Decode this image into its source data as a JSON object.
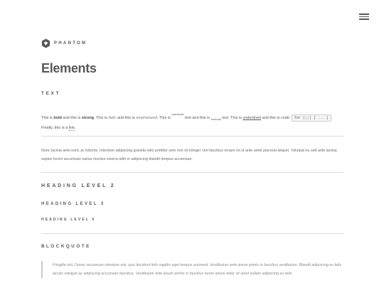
{
  "header": {
    "brand": "PHANTOM"
  },
  "page": {
    "title": "Elements"
  },
  "text_section": {
    "heading": "TEXT",
    "p1": [
      "This is ",
      "bold",
      " and this is ",
      "strong",
      ". This is ",
      "italic",
      " and this is ",
      "emphasized",
      ". This is ",
      "superscript",
      " text and this is ",
      "subscript",
      " text. This is ",
      "underlined",
      " and this is code: ",
      "for (;;) { ... }",
      ". Finally, this is a ",
      "link",
      "."
    ],
    "p2": "Nunc lacinia ante nunc ac lobortis. Interdum adipiscing gravida odio porttitor sem non mi integer non faucibus ornare mi ut ante amet placerat aliquet. Volutpat eu sed ante lacinia sapien lorem accumsan varius montes viverra nibh in adipiscing blandit tempus accumsan."
  },
  "headings": {
    "h2": "Heading Level 2",
    "h3": "Heading Level 3",
    "h4": "Heading Level 4"
  },
  "blockquote": {
    "heading": "Blockquote",
    "text": "Fringilla nisl. Donec accumsan interdum nisi, quis tincidunt felis sagittis eget tempus euismod. Vestibulum ante ipsum primis in faucibus vestibulum. Blandit adipiscing eu felis iaculis volutpat ac adipiscing accumsan faucibus. Vestibulum ante ipsum primis in faucibus lorem ipsum dolor sit amet nullam adipiscing eu felis."
  }
}
